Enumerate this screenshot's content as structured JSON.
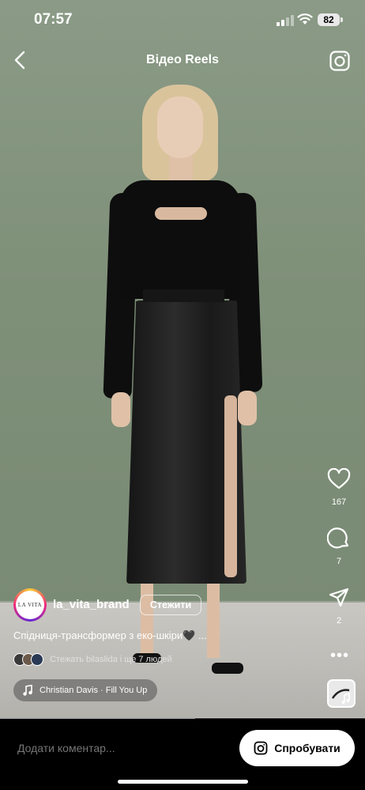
{
  "status": {
    "time": "07:57",
    "battery": "82"
  },
  "header": {
    "title": "Відео Reels"
  },
  "actions": {
    "likes": "167",
    "comments": "7",
    "shares": "2"
  },
  "post": {
    "username": "la_vita_brand",
    "avatar_text": "LA VITA",
    "follow_label": "Стежити",
    "caption": "Спідниця-трансформер з еко-шкіри🖤 ...",
    "followers_text": "Стежать bilaslida і ще 7 людей",
    "music": "Christian Davis · Fill You Up"
  },
  "playback": {
    "progress": 0.534
  },
  "bottom": {
    "comment_placeholder": "Додати коментар...",
    "try_label": "Спробувати"
  },
  "colors": {
    "wall": "#7f9079",
    "floor": "#bdbbb6",
    "accent_white": "#ffffff"
  }
}
